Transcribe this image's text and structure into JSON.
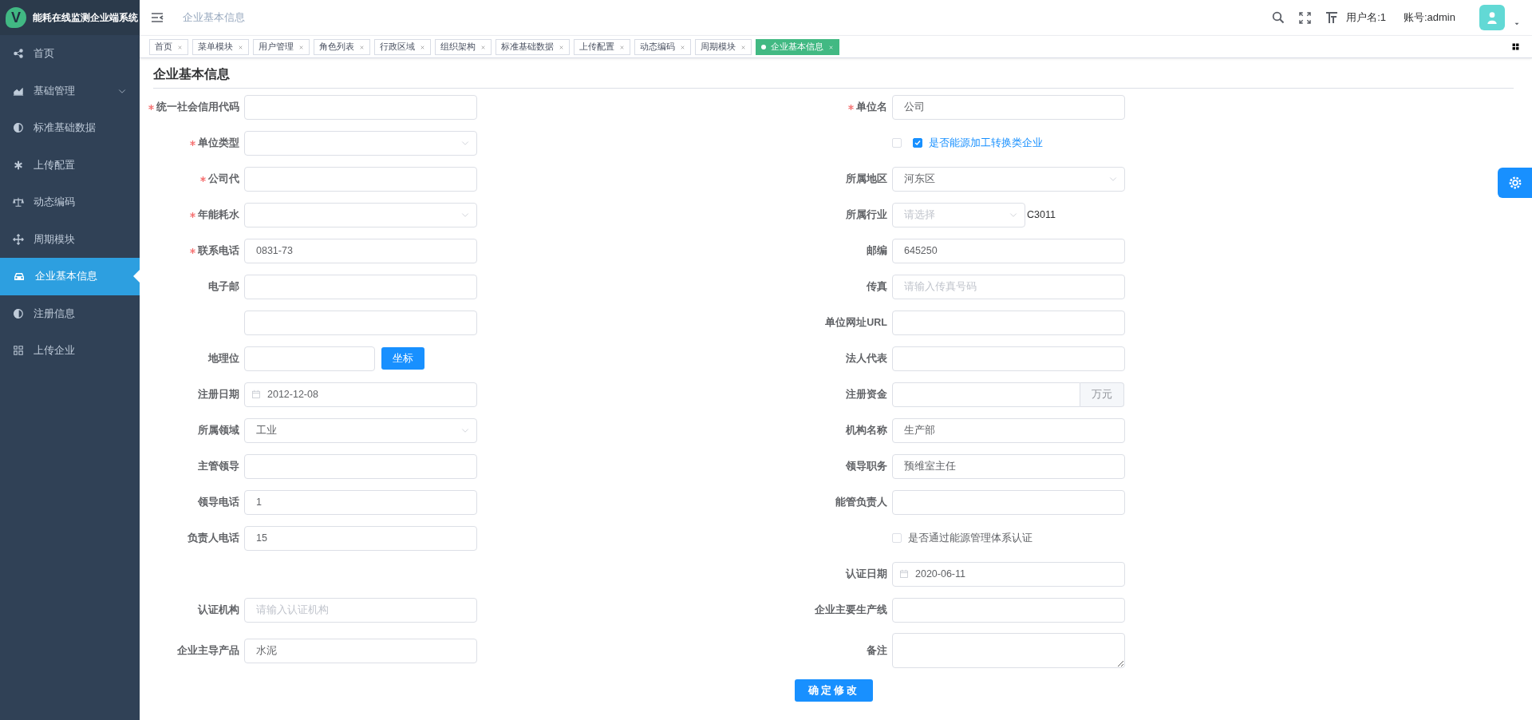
{
  "sidebar": {
    "logo_letter": "V",
    "title": "能耗在线监测企业端系统",
    "items": [
      {
        "label": "首页",
        "selected": false
      },
      {
        "label": "基础管理",
        "selected": false,
        "expanded": false
      },
      {
        "label": "标准基础数据",
        "selected": false
      },
      {
        "label": "上传配置",
        "selected": false
      },
      {
        "label": "动态编码",
        "selected": false
      },
      {
        "label": "周期模块",
        "selected": false
      },
      {
        "label": "企业基本信息",
        "selected": true
      },
      {
        "label": "注册信息",
        "selected": false
      },
      {
        "label": "上传企业",
        "selected": false
      }
    ]
  },
  "header": {
    "breadcrumb": "企业基本信息",
    "user": "用户名:1",
    "account": "账号:admin"
  },
  "tags": [
    {
      "label": "首页",
      "selected": false
    },
    {
      "label": "菜单模块",
      "selected": false
    },
    {
      "label": "用户管理",
      "selected": false
    },
    {
      "label": "角色列表",
      "selected": false
    },
    {
      "label": "行政区域",
      "selected": false
    },
    {
      "label": "组织架构",
      "selected": false
    },
    {
      "label": "标准基础数据",
      "selected": false
    },
    {
      "label": "上传配置",
      "selected": false
    },
    {
      "label": "动态编码",
      "selected": false
    },
    {
      "label": "周期模块",
      "selected": false
    },
    {
      "label": "企业基本信息",
      "selected": true
    }
  ],
  "form": {
    "title": "企业基本信息",
    "rows": [
      {
        "left": {
          "kind": "input",
          "label": "统一社会信用代码",
          "required": true
        },
        "right": {
          "kind": "input",
          "label": "单位名",
          "required": true,
          "value": "公司"
        }
      },
      {
        "left": {
          "kind": "select",
          "label": "单位类型",
          "required": true
        },
        "right": {
          "kind": "checkboxes",
          "options": [
            {
              "checked": false
            },
            {
              "label": "是否能源加工转换类企业",
              "checked": true
            }
          ]
        }
      },
      {
        "left": {
          "kind": "input",
          "label": "公司代",
          "required": true
        },
        "right": {
          "kind": "select",
          "label": "所属地区",
          "required": false,
          "value": "河东区"
        }
      },
      {
        "left": {
          "kind": "select",
          "label": "年能耗水",
          "required": true
        },
        "right": {
          "kind": "select-code",
          "label": "所属行业",
          "required": false,
          "placeholder": "请选择",
          "code": "C3011"
        }
      },
      {
        "left": {
          "kind": "input",
          "label": "联系电话",
          "required": true,
          "value": "0831-73"
        },
        "right": {
          "kind": "input",
          "label": "邮编",
          "required": false,
          "value": "645250"
        }
      },
      {
        "left": {
          "kind": "input",
          "label": "电子邮",
          "required": false
        },
        "right": {
          "kind": "input",
          "label": "传真",
          "required": false,
          "placeholder": "请输入传真号码"
        }
      },
      {
        "left": {
          "kind": "input"
        },
        "right": {
          "kind": "input",
          "label": "单位网址URL",
          "required": false
        }
      },
      {
        "left": {
          "kind": "input-button",
          "label": "地理位",
          "required": false,
          "button": "坐标"
        },
        "right": {
          "kind": "input",
          "label": "法人代表",
          "required": false
        }
      },
      {
        "left": {
          "kind": "date",
          "label": "注册日期",
          "required": false,
          "value": "2012-12-08"
        },
        "right": {
          "kind": "input-append",
          "label": "注册资金",
          "required": false,
          "append": "万元"
        }
      },
      {
        "left": {
          "kind": "select",
          "label": "所属领域",
          "required": false,
          "value": "工业"
        },
        "right": {
          "kind": "input",
          "label": "机构名称",
          "required": false,
          "value": "生产部"
        }
      },
      {
        "left": {
          "kind": "input",
          "label": "主管领导",
          "required": false
        },
        "right": {
          "kind": "input",
          "label": "领导职务",
          "required": false,
          "value": "预维室主任"
        }
      },
      {
        "left": {
          "kind": "input",
          "label": "领导电话",
          "required": false,
          "value": "1"
        },
        "right": {
          "kind": "input",
          "label": "能管负责人",
          "required": false
        }
      },
      {
        "left": {
          "kind": "input",
          "label": "负责人电话",
          "required": false,
          "value": "15"
        },
        "right": {
          "kind": "checkboxes",
          "options": [
            {
              "label": "是否通过能源管理体系认证",
              "checked": false
            }
          ]
        }
      },
      {
        "right": {
          "kind": "date",
          "label": "认证日期",
          "required": false,
          "value": "2020-06-11"
        }
      },
      {
        "left": {
          "kind": "input",
          "label": "认证机构",
          "required": false,
          "placeholder": "请输入认证机构"
        },
        "right": {
          "kind": "input",
          "label": "企业主要生产线",
          "required": false
        }
      },
      {
        "left": {
          "kind": "input",
          "label": "企业主导产品",
          "required": false,
          "value": "水泥"
        },
        "right": {
          "kind": "textarea",
          "label": "备注",
          "required": false
        }
      }
    ],
    "submit": "确定修改"
  }
}
